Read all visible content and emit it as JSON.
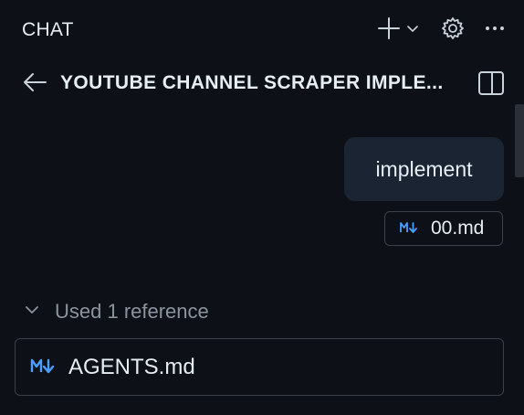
{
  "header": {
    "title": "CHAT",
    "icons": [
      "plus-icon",
      "chevron-down-icon",
      "gear-icon",
      "more-icon"
    ]
  },
  "session": {
    "title": "YOUTUBE CHANNEL SCRAPER IMPLE...",
    "icons": [
      "arrow-left-icon",
      "panel-icon"
    ]
  },
  "message": {
    "text": "implement",
    "attachment": "00.md",
    "attachment_icon": "markdown-icon"
  },
  "references": {
    "label": "Used 1 reference",
    "items": [
      {
        "label": "AGENTS.md",
        "icon": "markdown-icon"
      }
    ]
  },
  "colors": {
    "background": "#0d1117",
    "bubble": "#1b2433",
    "markdown_icon": "#4a9eff",
    "muted_text": "#8b949e",
    "border": "#3a414b"
  }
}
